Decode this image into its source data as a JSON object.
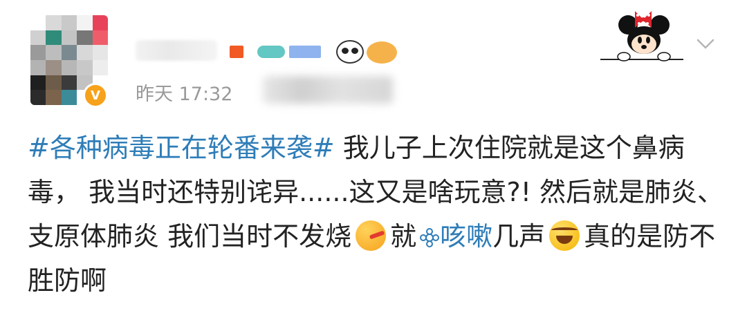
{
  "post": {
    "time": "昨天 17:32",
    "verified_badge": "V",
    "content": {
      "topic": "#各种病毒正在轮番来袭#",
      "text_1": "我儿子上次住院就是这个鼻病毒，  我当时还特别诧异......这又是啥玩意?!  然后就是肺炎、支原体肺炎 我们当时不发烧",
      "text_2": "就",
      "link_text": "咳嗽",
      "text_3": "几声",
      "text_4": "真的是防不胜防啊"
    },
    "icons": {
      "verified": "verified-v-icon",
      "thermometer_emoji": "face-with-thermometer-icon",
      "laugh_emoji": "laughing-tears-icon",
      "link": "link-flower-icon",
      "decoration": "minnie-mouse-icon",
      "expand": "chevron-down-icon"
    },
    "colors": {
      "link": "#2e7db8",
      "text": "#222222",
      "meta": "#9a9a9a",
      "verified": "#f7a21b"
    }
  }
}
